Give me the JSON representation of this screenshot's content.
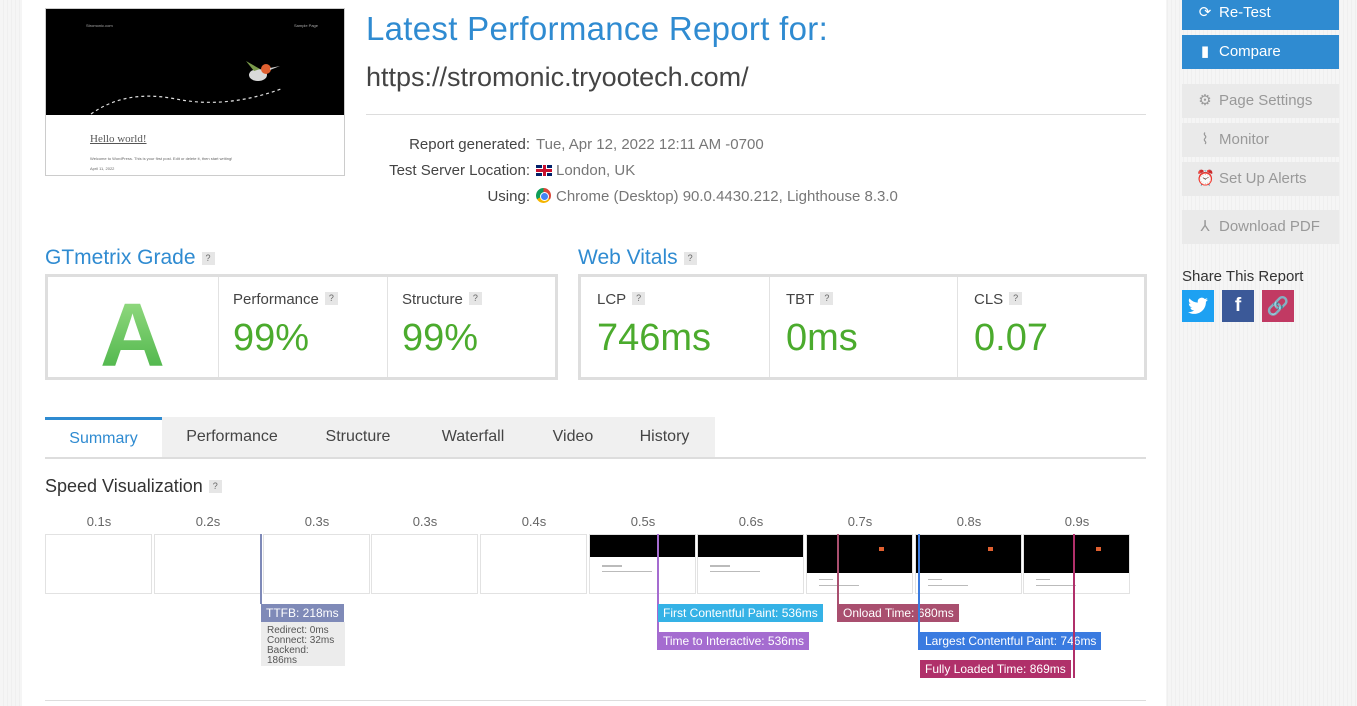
{
  "header": {
    "title": "Latest Performance Report for:",
    "url": "https://stromonic.tryootech.com/"
  },
  "thumbnail": {
    "site_name": "Stromonic.com",
    "sample_page": "Sample Page",
    "hello": "Hello world!",
    "welcome": "Welcome to WordPress. This is your first post. Edit or delete it, then start writing!",
    "date": "April 11, 2022"
  },
  "meta": {
    "generated_label": "Report generated:",
    "generated_value": "Tue, Apr 12, 2022 12:11 AM -0700",
    "location_label": "Test Server Location:",
    "location_value": "London, UK",
    "using_label": "Using:",
    "using_value": "Chrome (Desktop) 90.0.4430.212, Lighthouse 8.3.0"
  },
  "grade": {
    "heading": "GTmetrix Grade",
    "letter": "A",
    "performance_label": "Performance",
    "performance_value": "99%",
    "structure_label": "Structure",
    "structure_value": "99%"
  },
  "vitals": {
    "heading": "Web Vitals",
    "lcp_label": "LCP",
    "lcp_value": "746ms",
    "tbt_label": "TBT",
    "tbt_value": "0ms",
    "cls_label": "CLS",
    "cls_value": "0.07"
  },
  "tabs": [
    "Summary",
    "Performance",
    "Structure",
    "Waterfall",
    "Video",
    "History"
  ],
  "speed": {
    "heading": "Speed Visualization",
    "times": [
      "0.1s",
      "0.2s",
      "0.3s",
      "0.3s",
      "0.4s",
      "0.5s",
      "0.6s",
      "0.7s",
      "0.8s",
      "0.9s"
    ],
    "ttfb": "TTFB: 218ms",
    "redirect": "Redirect: 0ms",
    "connect": "Connect: 32ms",
    "backend": "Backend: 186ms",
    "fcp": "First Contentful Paint: 536ms",
    "tti": "Time to Interactive: 536ms",
    "onload": "Onload Time: 680ms",
    "lcp": "Largest Contentful Paint: 746ms",
    "fully_loaded": "Fully Loaded Time: 869ms"
  },
  "sidebar": {
    "retest": "Re-Test",
    "compare": "Compare",
    "page_settings": "Page Settings",
    "monitor": "Monitor",
    "alerts": "Set Up Alerts",
    "download": "Download PDF",
    "share_heading": "Share This Report"
  },
  "colors": {
    "accent": "#2f8bd1",
    "grade_green": "#4bab2d",
    "ttfb": "#7f8ab8",
    "fcp": "#35b2e6",
    "tti": "#a56cd0",
    "onload": "#a94f6f",
    "lcp": "#3a7be0",
    "fully_loaded": "#b0306a"
  }
}
